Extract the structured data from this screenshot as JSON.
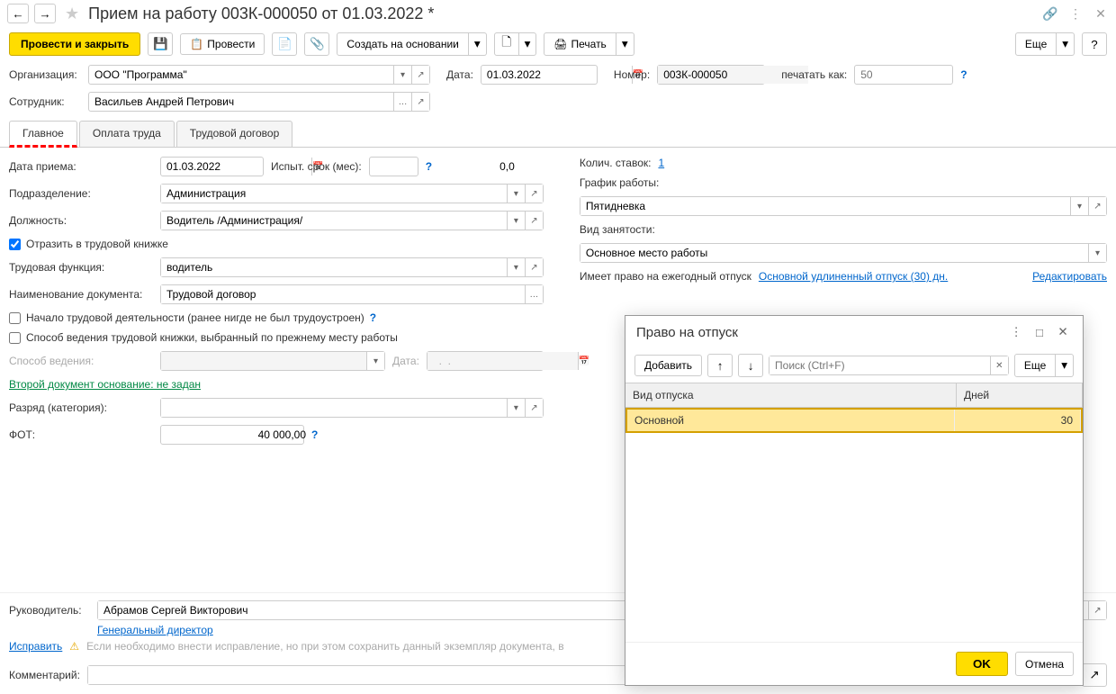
{
  "header": {
    "title": "Прием на работу 003К-000050 от 01.03.2022 *"
  },
  "toolbar": {
    "post_close": "Провести и закрыть",
    "post": "Провести",
    "create_based": "Создать на основании",
    "print": "Печать",
    "more": "Еще"
  },
  "form": {
    "org_label": "Организация:",
    "org_value": "ООО \"Программа\"",
    "date_label": "Дата:",
    "date_value": "01.03.2022",
    "number_label": "Номер:",
    "number_value": "003К-000050",
    "print_as_label": "печатать как:",
    "print_as_placeholder": "50",
    "employee_label": "Сотрудник:",
    "employee_value": "Васильев Андрей Петрович"
  },
  "tabs": [
    "Главное",
    "Оплата труда",
    "Трудовой договор"
  ],
  "main": {
    "hire_date_label": "Дата приема:",
    "hire_date": "01.03.2022",
    "probation_label": "Испыт. срок (мес):",
    "probation": "0,0",
    "department_label": "Подразделение:",
    "department": "Администрация",
    "position_label": "Должность:",
    "position": "Водитель /Администрация/",
    "reflect_labor_book": "Отразить в трудовой книжке",
    "labor_function_label": "Трудовая функция:",
    "labor_function": "водитель",
    "doc_name_label": "Наименование документа:",
    "doc_name": "Трудовой договор",
    "start_activity": "Начало трудовой деятельности (ранее нигде не был трудоустроен)",
    "book_method": "Способ ведения трудовой книжки, выбранный по прежнему месту работы",
    "method_label": "Способ ведения:",
    "date2_label": "Дата:",
    "date2_value": "  .  .    ",
    "second_doc": "Второй документ основание: не задан",
    "grade_label": "Разряд (категория):",
    "fot_label": "ФОТ:",
    "fot_value": "40 000,00"
  },
  "right": {
    "positions_count_label": "Колич. ставок:",
    "positions_count": "1",
    "schedule_label": "График работы:",
    "schedule": "Пятидневка",
    "employment_type_label": "Вид занятости:",
    "employment_type": "Основное место работы",
    "vacation_right_label": "Имеет право на ежегодный отпуск",
    "vacation_link": "Основной удлиненный отпуск (30) дн.",
    "edit_link": "Редактировать"
  },
  "footer": {
    "manager_label": "Руководитель:",
    "manager": "Абрамов Сергей Викторович",
    "manager_position": "Генеральный директор",
    "fix_link": "Исправить",
    "fix_note": "Если необходимо внести исправление, но при этом сохранить данный экземпляр документа, в",
    "comment_label": "Комментарий:"
  },
  "dialog": {
    "title": "Право на отпуск",
    "add": "Добавить",
    "search_placeholder": "Поиск (Ctrl+F)",
    "more": "Еще",
    "col_type": "Вид отпуска",
    "col_days": "Дней",
    "rows": [
      {
        "type": "Основной",
        "days": "30"
      }
    ],
    "ok": "OK",
    "cancel": "Отмена"
  }
}
